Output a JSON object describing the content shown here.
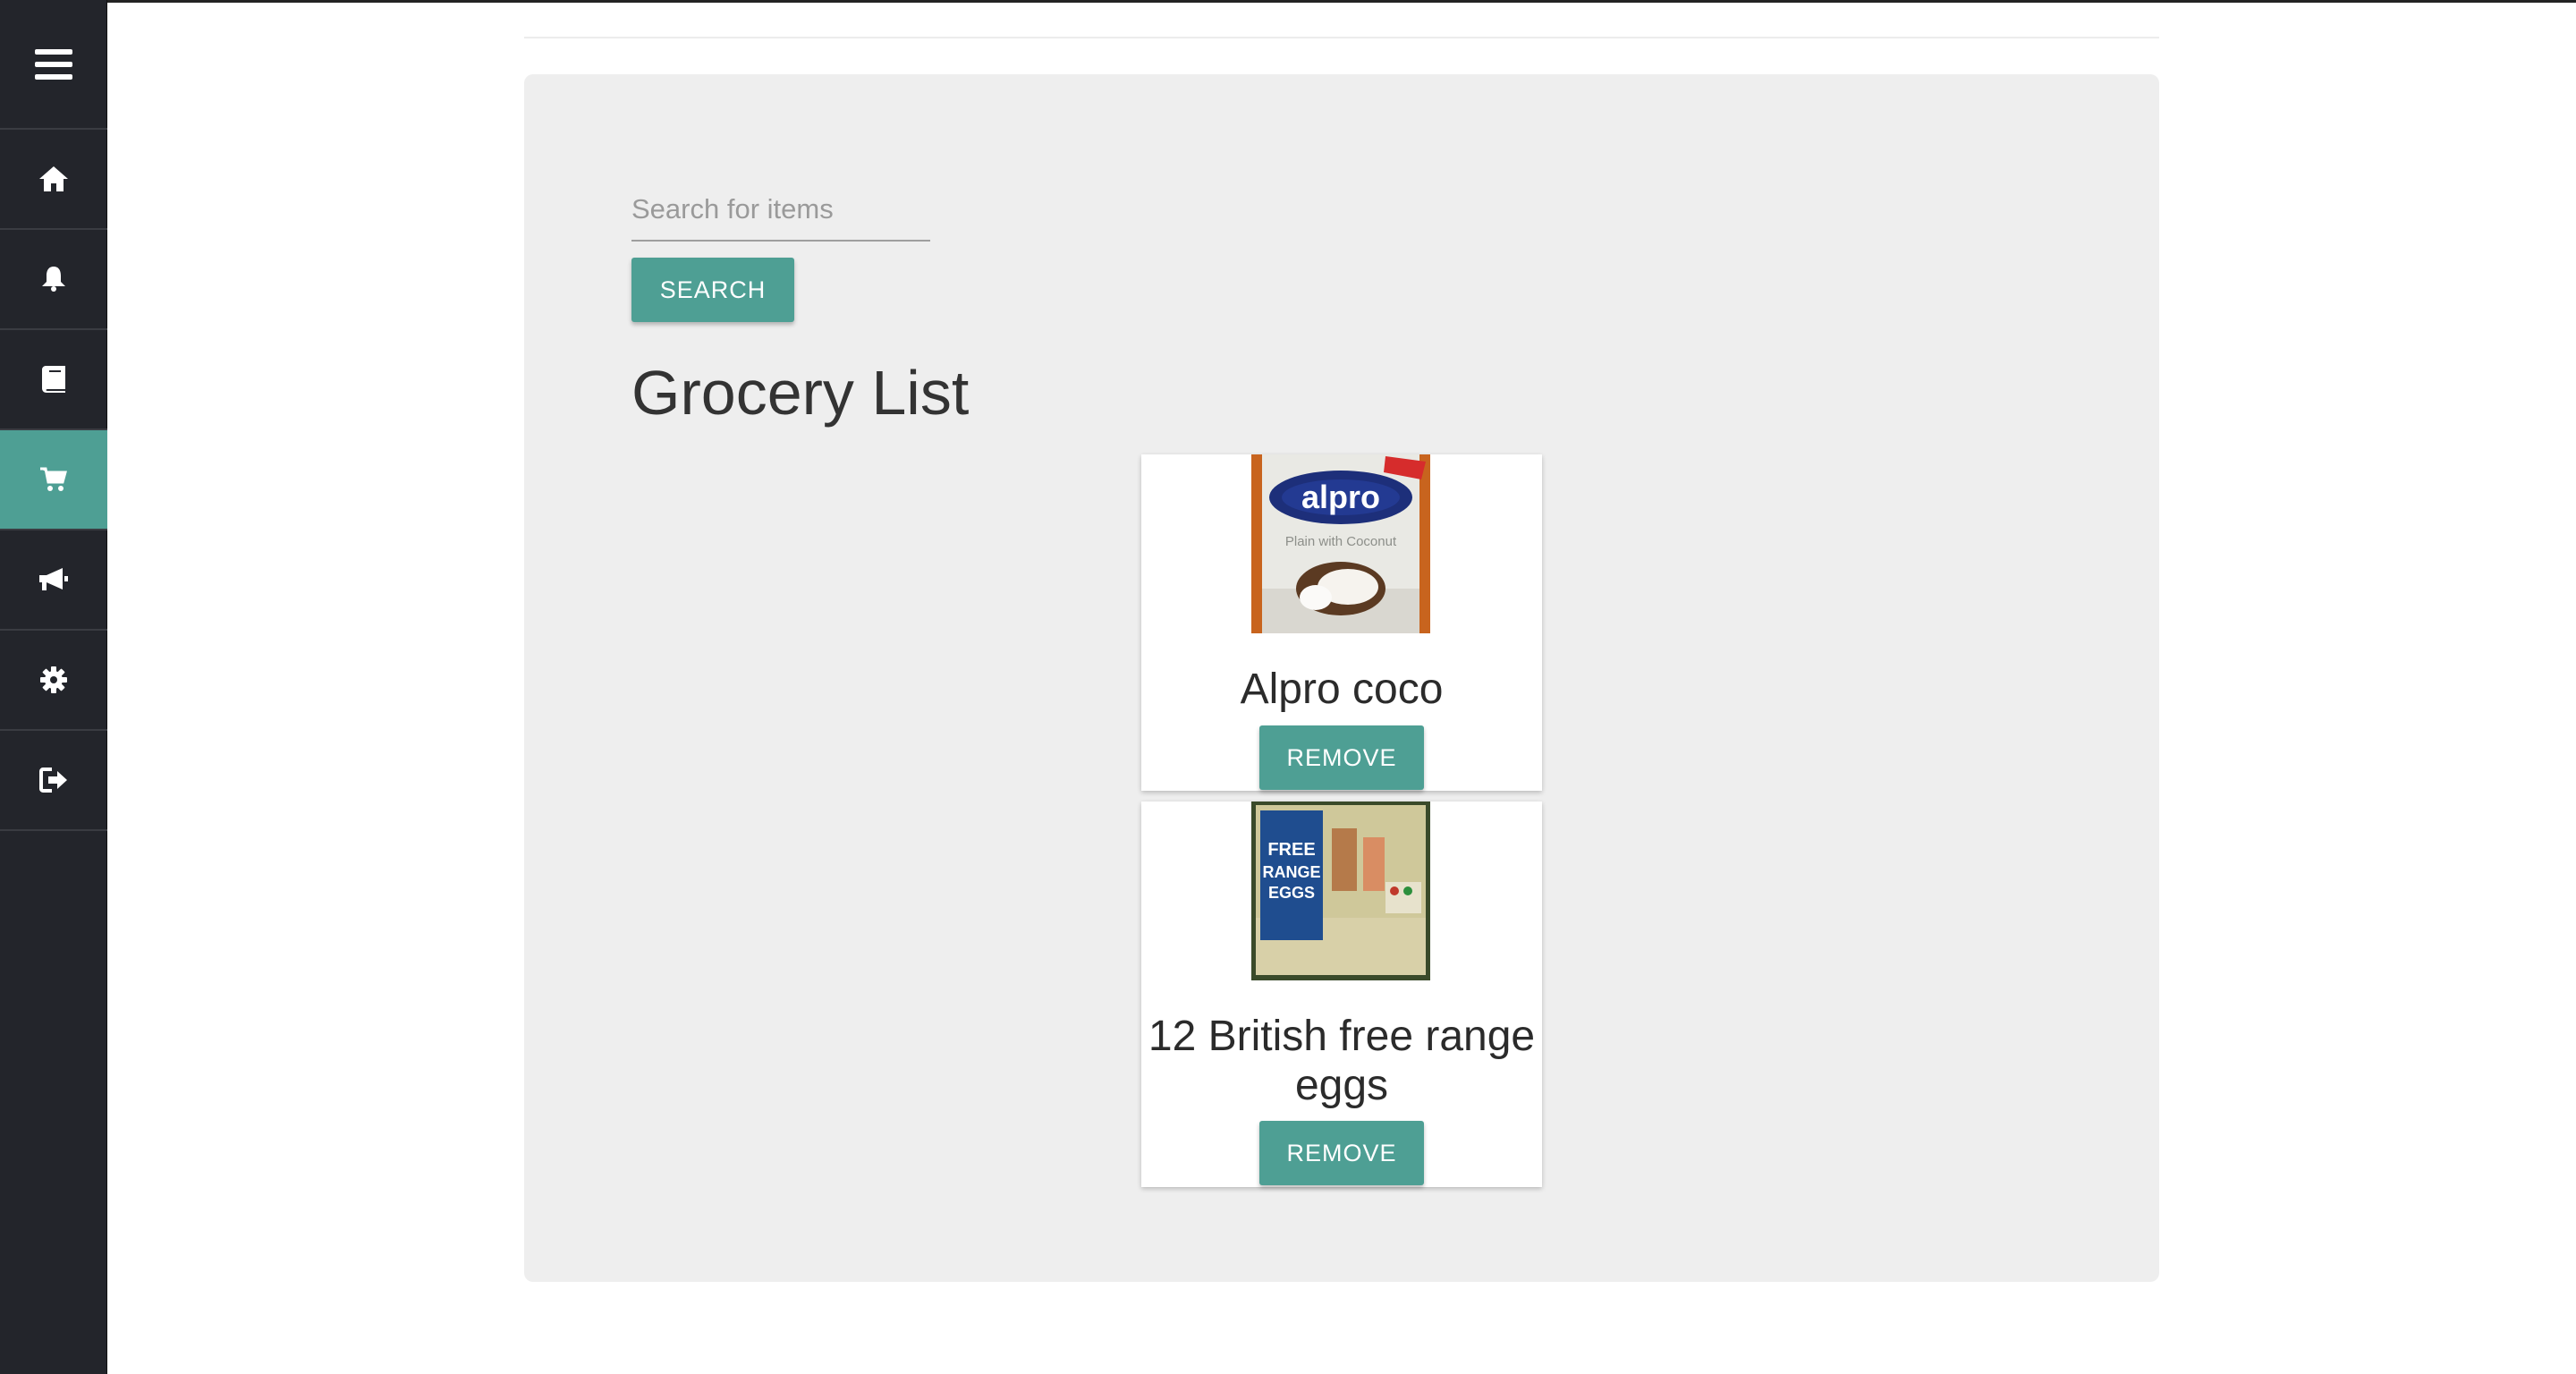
{
  "search": {
    "placeholder": "Search for items",
    "button_label": "SEARCH"
  },
  "page": {
    "title": "Grocery List"
  },
  "sidebar": {
    "items": [
      {
        "icon": "menu-icon"
      },
      {
        "icon": "home-icon"
      },
      {
        "icon": "bell-icon"
      },
      {
        "icon": "book-icon"
      },
      {
        "icon": "cart-icon",
        "active": true
      },
      {
        "icon": "megaphone-icon"
      },
      {
        "icon": "gear-icon"
      },
      {
        "icon": "sign-out-icon"
      }
    ]
  },
  "items": [
    {
      "name": "Alpro coco",
      "remove_label": "REMOVE"
    },
    {
      "name": "12 British free range eggs",
      "remove_label": "REMOVE"
    }
  ],
  "colors": {
    "sidebar": "#23252b",
    "accent": "#4e9f94",
    "panel": "#eeeeee"
  }
}
